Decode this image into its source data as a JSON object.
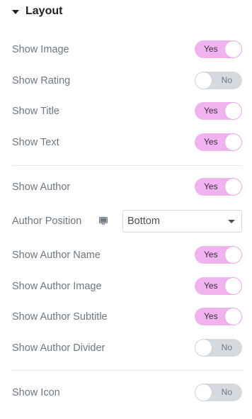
{
  "section": {
    "title": "Layout"
  },
  "rows": {
    "show_image": {
      "label": "Show Image",
      "state": "Yes"
    },
    "show_rating": {
      "label": "Show Rating",
      "state": "No"
    },
    "show_title": {
      "label": "Show Title",
      "state": "Yes"
    },
    "show_text": {
      "label": "Show Text",
      "state": "Yes"
    },
    "show_author": {
      "label": "Show Author",
      "state": "Yes"
    },
    "author_position": {
      "label": "Author Position",
      "value": "Bottom"
    },
    "show_author_name": {
      "label": "Show Author Name",
      "state": "Yes"
    },
    "show_author_image": {
      "label": "Show Author Image",
      "state": "Yes"
    },
    "show_author_subtitle": {
      "label": "Show Author Subtitle",
      "state": "Yes"
    },
    "show_author_divider": {
      "label": "Show Author Divider",
      "state": "No"
    },
    "show_icon": {
      "label": "Show Icon",
      "state": "No"
    }
  },
  "colors": {
    "toggle_on": "#f0b3f0",
    "toggle_off": "#d5dadf",
    "label": "#6d7882",
    "heading": "#1f2124"
  },
  "icons": {
    "section_caret": "caret-down-icon",
    "responsive": "desktop-icon",
    "select_caret": "chevron-down-icon"
  }
}
